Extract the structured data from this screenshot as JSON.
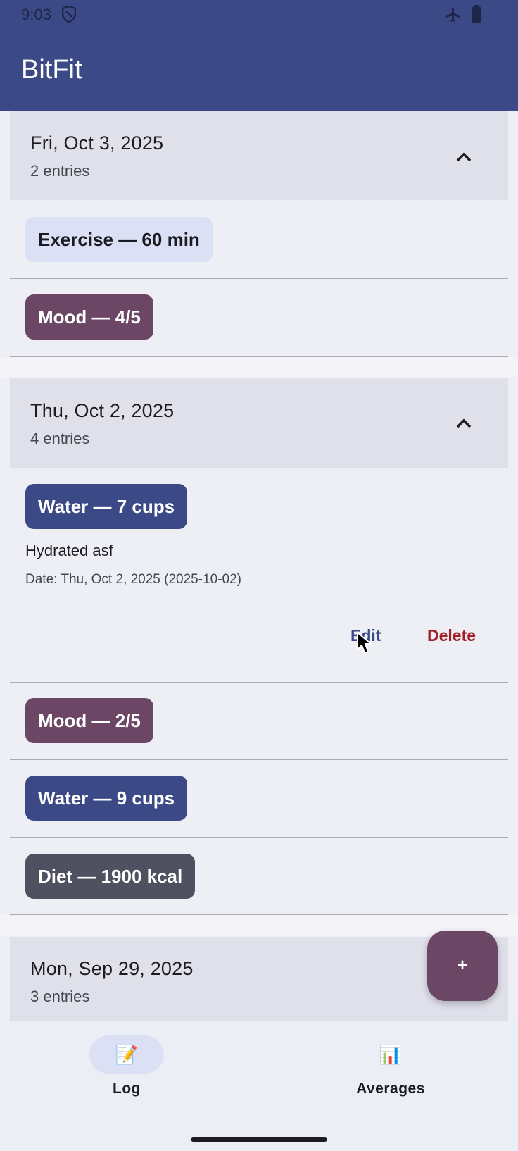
{
  "status_bar": {
    "time": "9:03",
    "icons": [
      "shield-icon",
      "airplane-icon",
      "battery-icon"
    ]
  },
  "app": {
    "title": "BitFit"
  },
  "days": [
    {
      "title": "Fri, Oct 3, 2025",
      "count": "2 entries",
      "entries": [
        {
          "label": "Exercise — 60 min",
          "type": "exercise"
        },
        {
          "label": "Mood — 4/5",
          "type": "mood"
        }
      ]
    },
    {
      "title": "Thu, Oct 2, 2025",
      "count": "4 entries",
      "entries": [
        {
          "label": "Water — 7 cups",
          "type": "water",
          "note": "Hydrated asf",
          "date": "Date: Thu, Oct 2, 2025 (2025-10-02)",
          "edit_label": "Edit",
          "delete_label": "Delete"
        },
        {
          "label": "Mood — 2/5",
          "type": "mood"
        },
        {
          "label": "Water — 9 cups",
          "type": "water"
        },
        {
          "label": "Diet — 1900 kcal",
          "type": "diet"
        }
      ]
    },
    {
      "title": "Mon, Sep 29, 2025",
      "count": "3 entries"
    }
  ],
  "fab": {
    "label": "+"
  },
  "bottom_nav": {
    "items": [
      {
        "label": "Log",
        "icon": "memo-icon",
        "glyph": "📝",
        "active": true
      },
      {
        "label": "Averages",
        "icon": "bar-chart-icon",
        "glyph": "📊",
        "active": false
      }
    ]
  },
  "colors": {
    "primary": "#3b4a86",
    "mood": "#6b4665",
    "diet": "#4f5161",
    "exercise": "#dbe0f5",
    "delete": "#a11f26"
  }
}
